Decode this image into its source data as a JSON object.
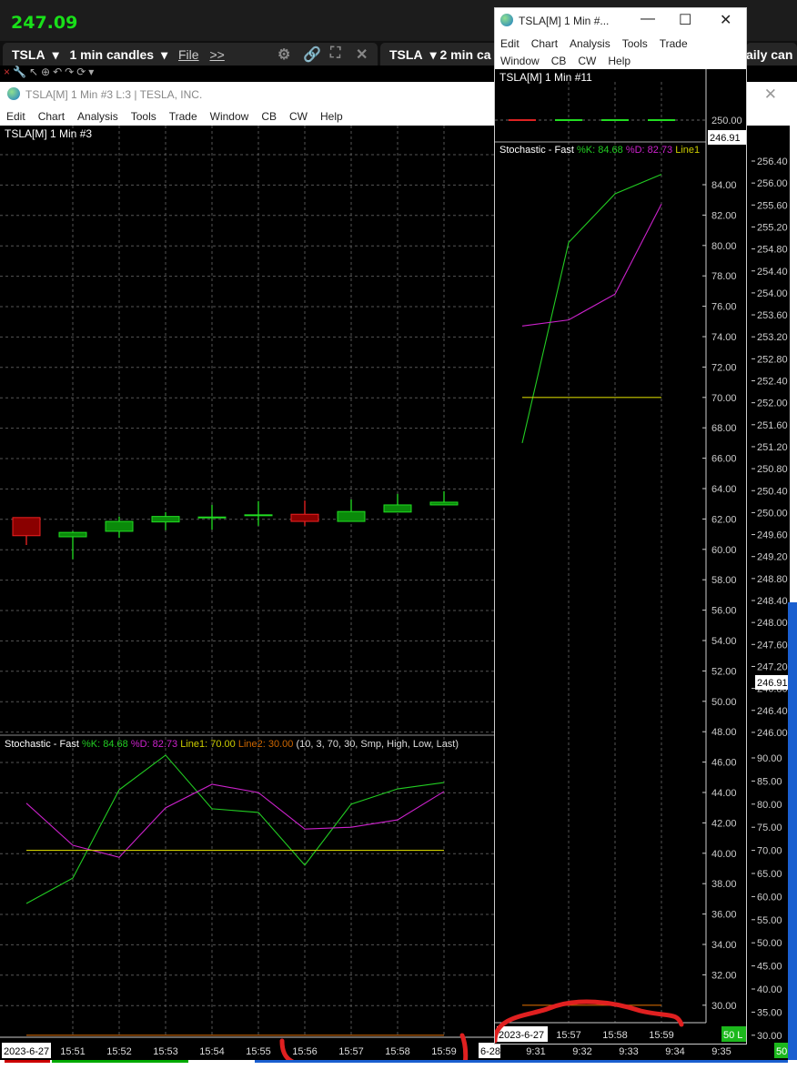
{
  "top": {
    "last_price": "247.09"
  },
  "tabs": [
    {
      "symbol": "TSLA",
      "interval": "1 min candles",
      "file": "File",
      "more": ">>"
    },
    {
      "symbol": "TSLA",
      "interval": "2 min ca"
    },
    {
      "interval": "aily can"
    }
  ],
  "main_window": {
    "title": "TSLA[M]  1 Min   #3 L:3 | TESLA, INC.",
    "menu": [
      "Edit",
      "Chart",
      "Analysis",
      "Tools",
      "Trade",
      "Window",
      "CB",
      "CW",
      "Help"
    ],
    "chart_label": "TSLA[M]  1 Min   #3",
    "stoch_legend": {
      "name": "Stochastic - Fast",
      "k": "%K: 84.68",
      "d": "%D: 82.73",
      "line1": "Line1: 70.00",
      "line2": "Line2: 30.00",
      "params": "(10, 3, 70, 30, Smp, High, Low, Last)"
    },
    "date_label": "2023-6-27",
    "date_label2": "6-28",
    "volume_badge": "50",
    "price_tag": "246.91"
  },
  "small_window": {
    "title": "TSLA[M]  1 Min  #...",
    "menu_row1": [
      "Edit",
      "Chart",
      "Analysis",
      "Tools",
      "Trade"
    ],
    "menu_row2": [
      "Window",
      "CB",
      "CW",
      "Help"
    ],
    "chart_label": "TSLA[M]  1 Min   #11",
    "stoch_legend": {
      "name": "Stochastic - Fast",
      "k": "%K: 84.68",
      "d": "%D: 82.73",
      "line1": "Line1"
    },
    "date_label": "2023-6-27",
    "volume_badge": "50 L",
    "price_tag": "246.91",
    "price_tick": "250.00"
  },
  "colors": {
    "k": "#22cc22",
    "d": "#cc22cc",
    "line1": "#cccc00",
    "line2": "#cc6600",
    "up": "#0a8a0a",
    "down": "#8a0000",
    "price_text": "#19e019"
  },
  "chart_data": [
    {
      "type": "candlestick",
      "title": "TSLA[M] 1 Min #3",
      "x": [
        "15:50",
        "15:51",
        "15:52",
        "15:53",
        "15:54",
        "15:55",
        "15:56",
        "15:57",
        "15:58",
        "15:59"
      ],
      "open": [
        249.91,
        249.56,
        249.66,
        249.83,
        249.92,
        249.96,
        249.97,
        249.84,
        250.01,
        250.14
      ],
      "high": [
        249.91,
        249.66,
        249.93,
        250.01,
        250.14,
        250.21,
        250.22,
        250.24,
        250.34,
        250.39
      ],
      "low": [
        249.41,
        249.15,
        249.54,
        249.68,
        249.69,
        249.76,
        249.76,
        249.84,
        250.01,
        250.14
      ],
      "close": [
        249.58,
        249.64,
        249.84,
        249.93,
        249.92,
        249.96,
        249.84,
        250.02,
        250.14,
        250.19
      ],
      "y_ticks": [
        "256.40",
        "256.00",
        "255.60",
        "255.20",
        "254.80",
        "254.40",
        "254.00",
        "253.60",
        "253.20",
        "252.80",
        "252.40",
        "252.00",
        "251.60",
        "251.20",
        "250.80",
        "250.40",
        "250.00",
        "249.60",
        "249.20",
        "248.80",
        "248.40",
        "248.00",
        "247.60",
        "247.20",
        "246.80",
        "246.40",
        "246.00"
      ],
      "ylim": [
        246.0,
        256.4
      ],
      "x_ticks": [
        "15:51",
        "15:52",
        "15:53",
        "15:54",
        "15:55",
        "15:56",
        "15:57",
        "15:58",
        "15:59",
        "9:31",
        "9:32",
        "9:33",
        "9:34",
        "9:35"
      ]
    },
    {
      "type": "line",
      "title": "Stochastic - Fast",
      "x": [
        "15:50",
        "15:51",
        "15:52",
        "15:53",
        "15:54",
        "15:55",
        "15:56",
        "15:57",
        "15:58",
        "15:59"
      ],
      "series": [
        {
          "name": "%K",
          "values": [
            58.5,
            64.0,
            83.1,
            90.6,
            79.0,
            78.2,
            66.8,
            80.0,
            83.3,
            84.68
          ]
        },
        {
          "name": "%D",
          "values": [
            80.2,
            71.1,
            68.5,
            79.2,
            84.3,
            82.5,
            74.6,
            75.0,
            76.6,
            82.73
          ]
        },
        {
          "name": "Line1",
          "values": [
            70,
            70,
            70,
            70,
            70,
            70,
            70,
            70,
            70,
            70
          ]
        },
        {
          "name": "Line2",
          "values": [
            30,
            30,
            30,
            30,
            30,
            30,
            30,
            30,
            30,
            30
          ]
        }
      ],
      "y_ticks": [
        "90.00",
        "85.00",
        "80.00",
        "75.00",
        "70.00",
        "65.00",
        "60.00",
        "55.00",
        "50.00",
        "45.00",
        "40.00",
        "35.00",
        "30.00"
      ],
      "ylim": [
        30,
        90
      ]
    },
    {
      "type": "line",
      "title": "Stochastic - Fast (#11)",
      "x": [
        "15:56",
        "15:57",
        "15:58",
        "15:59"
      ],
      "series": [
        {
          "name": "%K",
          "values": [
            67.0,
            80.2,
            83.4,
            84.68
          ]
        },
        {
          "name": "%D",
          "values": [
            74.7,
            75.1,
            76.8,
            82.73
          ]
        },
        {
          "name": "Line1",
          "values": [
            70,
            70,
            70,
            70
          ]
        },
        {
          "name": "Line2",
          "values": [
            30,
            30,
            30,
            30
          ]
        }
      ],
      "y_ticks": [
        "84.00",
        "82.00",
        "80.00",
        "78.00",
        "76.00",
        "74.00",
        "72.00",
        "70.00",
        "68.00",
        "66.00",
        "64.00",
        "62.00",
        "60.00",
        "58.00",
        "56.00",
        "54.00",
        "52.00",
        "50.00",
        "48.00",
        "46.00",
        "44.00",
        "42.00",
        "40.00",
        "38.00",
        "36.00",
        "34.00",
        "32.00",
        "30.00"
      ],
      "ylim": [
        29.5,
        85
      ],
      "x_ticks": [
        "15:57",
        "15:58",
        "15:59"
      ]
    }
  ]
}
